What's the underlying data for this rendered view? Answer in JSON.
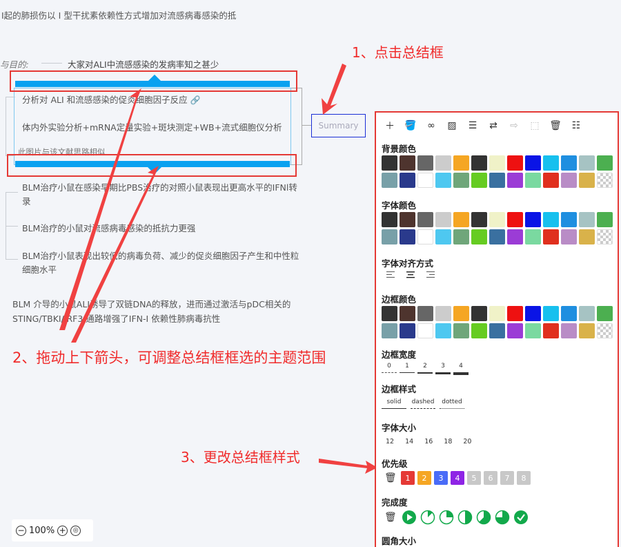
{
  "mindmap": {
    "root_text": "I起的肺损伤以 I 型干扰素依赖性方式增加对流感病毒感染的抵",
    "purpose_label": "与目的:",
    "purpose_text": "大家对ALI中流感感染的发病率知之甚少",
    "child1": "分析对 ALI 和流感感染的促炎细胞因子反应",
    "child2": "体内外实验分析+mRNA定量实验+斑块测定+WB+流式细胞仪分析",
    "child3": "此图片与该文献思路相似",
    "summary_label": "Summary",
    "result1_line1": "BLM治疗小鼠在感染早期比PBS治疗的对照小鼠表现出更高水平的IFNl转",
    "result1_line2": "录",
    "result2": "BLM治疗的小鼠对流感病毒感染的抵抗力更强",
    "result3_line1": "BLM治疗小鼠表现出较低的病毒负荷、减少的促炎细胞因子产生和中性粒",
    "result3_line2": "细胞水平",
    "conclusion_line1": "BLM 介导的小鼠ALI诱导了双链DNA的释放，进而通过激活与pDC相关的",
    "conclusion_line2": "STING/TBKI/IRF3 通路增强了IFN-I 依赖性肺病毒抗性"
  },
  "annotations": {
    "step1": "1、点击总结框",
    "step2": "2、拖动上下箭头，可调整总结框框选的主题范围",
    "step3": "3、更改总结框样式"
  },
  "panel": {
    "toolbar_icons": [
      "plus-icon",
      "paint-bucket-icon",
      "link-icon",
      "image-icon",
      "note-icon",
      "relation-icon",
      "tag-icon",
      "dashed-box-icon",
      "trash-icon",
      "structure-icon"
    ],
    "bg_color_title": "背景颜色",
    "font_color_title": "字体颜色",
    "align_title": "字体对齐方式",
    "border_color_title": "边框颜色",
    "border_width_title": "边框宽度",
    "border_widths": [
      "0",
      "1",
      "2",
      "3",
      "4"
    ],
    "border_style_title": "边框样式",
    "border_styles": [
      "solid",
      "dashed",
      "dotted"
    ],
    "font_size_title": "字体大小",
    "font_sizes": [
      "12",
      "14",
      "16",
      "18",
      "20"
    ],
    "priority_title": "优先级",
    "priorities": [
      "1",
      "2",
      "3",
      "4",
      "5",
      "6",
      "7",
      "8"
    ],
    "priority_colors": [
      "#e53935",
      "#f5a623",
      "#4a6cf7",
      "#8e24e5",
      "#c8c8c8",
      "#c8c8c8",
      "#c8c8c8",
      "#c8c8c8"
    ],
    "progress_title": "完成度",
    "radius_title": "圆角大小",
    "palette": [
      "#333333",
      "#4e342e",
      "#666666",
      "#cccccc",
      "#f5a623",
      "#333333",
      "#f0f2c8",
      "#ee1111",
      "#0a14e6",
      "#17c0ee",
      "#1f8fe0",
      "#a6c3c3",
      "#4caf50",
      "#78a0a8",
      "#2a3a8c",
      "#ffffff",
      "#4ec8f0",
      "#6fa67a",
      "#66cc22",
      "#3a70a0",
      "#9b3cd6",
      "#7ad9a0",
      "#e0301e",
      "#b98cc6",
      "#d9b24a",
      "none"
    ]
  },
  "zoom": {
    "value": "100%"
  }
}
